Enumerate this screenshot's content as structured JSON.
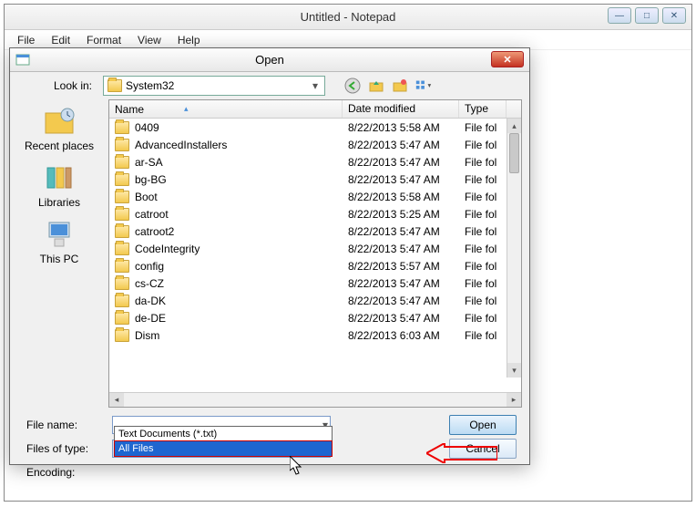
{
  "notepad": {
    "title": "Untitled - Notepad",
    "menu": {
      "file": "File",
      "edit": "Edit",
      "format": "Format",
      "view": "View",
      "help": "Help"
    }
  },
  "dialog": {
    "title": "Open",
    "lookin_label": "Look in:",
    "lookin_value": "System32",
    "places": {
      "recent": "Recent places",
      "libraries": "Libraries",
      "thispc": "This PC"
    },
    "columns": {
      "name": "Name",
      "date": "Date modified",
      "type": "Type"
    },
    "rows": [
      {
        "name": "0409",
        "date": "8/22/2013 5:58 AM",
        "type": "File fol"
      },
      {
        "name": "AdvancedInstallers",
        "date": "8/22/2013 5:47 AM",
        "type": "File fol"
      },
      {
        "name": "ar-SA",
        "date": "8/22/2013 5:47 AM",
        "type": "File fol"
      },
      {
        "name": "bg-BG",
        "date": "8/22/2013 5:47 AM",
        "type": "File fol"
      },
      {
        "name": "Boot",
        "date": "8/22/2013 5:58 AM",
        "type": "File fol"
      },
      {
        "name": "catroot",
        "date": "8/22/2013 5:25 AM",
        "type": "File fol"
      },
      {
        "name": "catroot2",
        "date": "8/22/2013 5:47 AM",
        "type": "File fol"
      },
      {
        "name": "CodeIntegrity",
        "date": "8/22/2013 5:47 AM",
        "type": "File fol"
      },
      {
        "name": "config",
        "date": "8/22/2013 5:57 AM",
        "type": "File fol"
      },
      {
        "name": "cs-CZ",
        "date": "8/22/2013 5:47 AM",
        "type": "File fol"
      },
      {
        "name": "da-DK",
        "date": "8/22/2013 5:47 AM",
        "type": "File fol"
      },
      {
        "name": "de-DE",
        "date": "8/22/2013 5:47 AM",
        "type": "File fol"
      },
      {
        "name": "Dism",
        "date": "8/22/2013 6:03 AM",
        "type": "File fol"
      }
    ],
    "filename_label": "File name:",
    "filename_value": "",
    "filetype_label": "Files of type:",
    "filetype_value": "All Files",
    "filetype_options": {
      "txt": "Text Documents (*.txt)",
      "all": "All Files"
    },
    "encoding_label": "Encoding:",
    "open_btn": "Open",
    "cancel_btn": "Cancel"
  }
}
